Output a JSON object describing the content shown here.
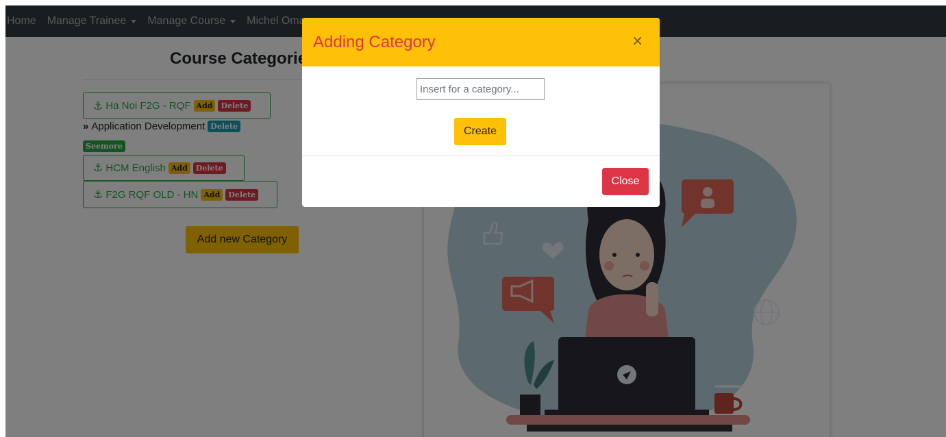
{
  "nav": {
    "items": [
      {
        "label": "Home",
        "dropdown": false
      },
      {
        "label": "Manage Trainee",
        "dropdown": true
      },
      {
        "label": "Manage Course",
        "dropdown": true
      },
      {
        "label": "Michel Omar",
        "dropdown": true
      }
    ]
  },
  "page": {
    "title": "Course Categories",
    "add_category_label": "Add new Category"
  },
  "categories": [
    {
      "name": "Ha Noi F2G - RQF",
      "add_label": "Add",
      "delete_label": "Delete"
    },
    {
      "name": "HCM English",
      "add_label": "Add",
      "delete_label": "Delete"
    },
    {
      "name": "F2G RQF OLD - HN",
      "add_label": "Add",
      "delete_label": "Delete"
    }
  ],
  "sub_items": [
    {
      "name": "Application Development",
      "delete_label": "Delete",
      "seemore_label": "Seemore"
    }
  ],
  "modal": {
    "title": "Adding Category",
    "close_symbol": "×",
    "input_placeholder": "Insert for a category...",
    "create_label": "Create",
    "close_label": "Close"
  },
  "colors": {
    "navbar": "#343a40",
    "warning": "#ffc107",
    "danger": "#dc3545",
    "success": "#28a745",
    "info": "#17a2b8"
  }
}
